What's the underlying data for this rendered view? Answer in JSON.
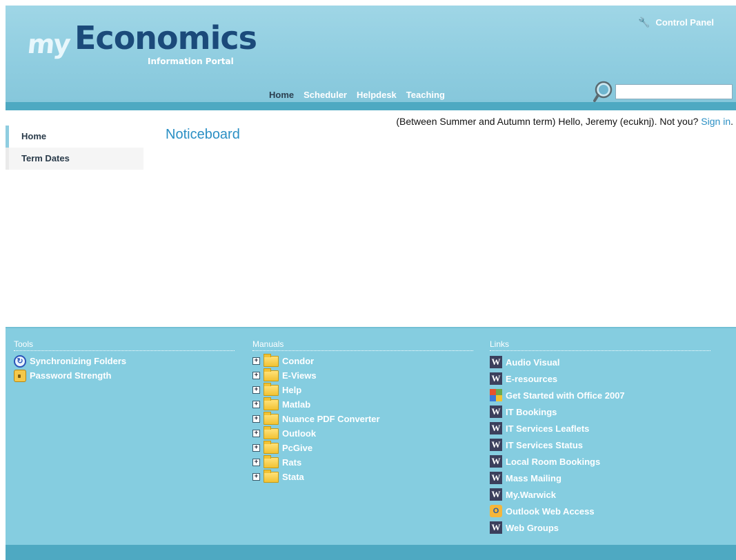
{
  "header": {
    "logo_my": "my",
    "logo_econ": "Economics",
    "logo_sub": "Information Portal",
    "control_panel": "Control Panel",
    "search_placeholder": ""
  },
  "topnav": [
    {
      "label": "Home"
    },
    {
      "label": "Scheduler"
    },
    {
      "label": "Helpdesk"
    },
    {
      "label": "Teaching"
    }
  ],
  "greeting": {
    "text": "(Between Summer and Autumn term) Hello, Jeremy (ecuknj). Not you? ",
    "link": "Sign in",
    "tail": "."
  },
  "sidebar": {
    "items": [
      {
        "label": "Home"
      },
      {
        "label": "Term Dates"
      }
    ]
  },
  "main": {
    "title": "Noticeboard"
  },
  "footer": {
    "tools": {
      "title": "Tools",
      "items": [
        {
          "label": "Synchronizing Folders",
          "icon": "sync-icon"
        },
        {
          "label": "Password Strength",
          "icon": "lock-icon"
        }
      ]
    },
    "manuals": {
      "title": "Manuals",
      "items": [
        {
          "label": "Condor"
        },
        {
          "label": "E-Views"
        },
        {
          "label": "Help"
        },
        {
          "label": "Matlab"
        },
        {
          "label": "Nuance PDF Converter"
        },
        {
          "label": "Outlook"
        },
        {
          "label": "PcGive"
        },
        {
          "label": "Rats"
        },
        {
          "label": "Stata"
        }
      ]
    },
    "links": {
      "title": "Links",
      "items": [
        {
          "label": "Audio Visual",
          "icon": "w-icon"
        },
        {
          "label": "E-resources",
          "icon": "w-icon"
        },
        {
          "label": "Get Started with Office 2007",
          "icon": "office-icon"
        },
        {
          "label": "IT Bookings",
          "icon": "w-icon"
        },
        {
          "label": "IT Services Leaflets",
          "icon": "w-icon"
        },
        {
          "label": "IT Services Status",
          "icon": "w-icon"
        },
        {
          "label": "Local Room Bookings",
          "icon": "w-icon"
        },
        {
          "label": "Mass Mailing",
          "icon": "w-icon"
        },
        {
          "label": "My.Warwick",
          "icon": "w-icon"
        },
        {
          "label": "Outlook Web Access",
          "icon": "owa-icon"
        },
        {
          "label": "Web Groups",
          "icon": "w-icon"
        }
      ]
    }
  }
}
